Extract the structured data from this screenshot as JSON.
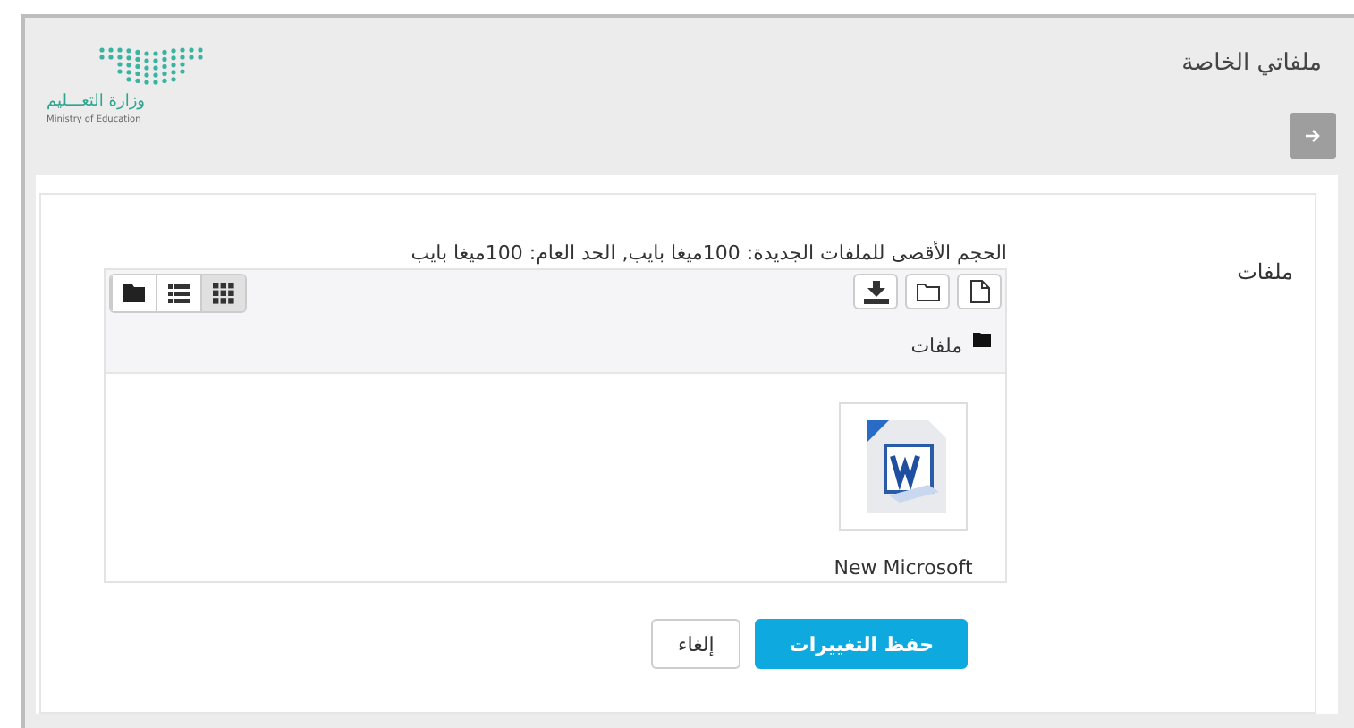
{
  "header": {
    "title": "ملفاتي الخاصة",
    "logo": {
      "arabic": "وزارة التعـــليم",
      "english": "Ministry of Education"
    }
  },
  "form": {
    "label": "ملفات",
    "limits": "الحجم الأقصى للملفات الجديدة: 100ميغا بايب, الحد العام: 100ميغا بايب",
    "view_modes": [
      {
        "kind": "grid",
        "selected": true
      },
      {
        "kind": "list",
        "selected": false
      },
      {
        "kind": "tree",
        "selected": false
      }
    ],
    "path": "ملفات",
    "files": [
      {
        "name": "New Microsoft",
        "kind": "word"
      }
    ]
  },
  "buttons": [
    {
      "label": "حفظ التغييرات",
      "kind": "primary"
    },
    {
      "label": "إلغاء",
      "kind": "default"
    }
  ]
}
